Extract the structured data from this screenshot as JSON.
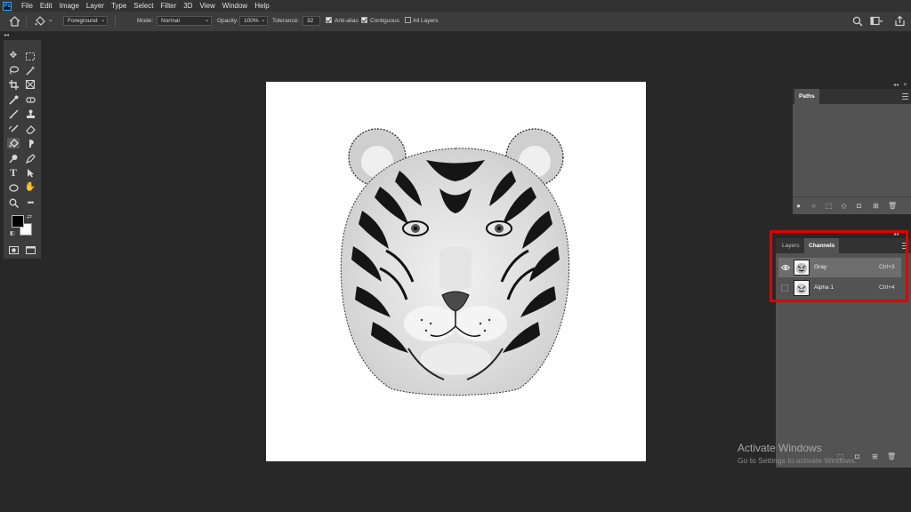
{
  "menubar": {
    "logo": "Ps",
    "items": [
      "File",
      "Edit",
      "Image",
      "Layer",
      "Type",
      "Select",
      "Filter",
      "3D",
      "View",
      "Window",
      "Help"
    ]
  },
  "options": {
    "fill_source": "Foreground",
    "mode_label": "Mode:",
    "mode_value": "Normal",
    "opacity_label": "Opacity:",
    "opacity_value": "100%",
    "tolerance_label": "Tolerance:",
    "tolerance_value": "32",
    "anti_alias": "Anti-alias",
    "contiguous": "Contiguous",
    "all_layers": "All Layers",
    "anti_alias_checked": true,
    "contiguous_checked": true,
    "all_layers_checked": false
  },
  "paths_panel": {
    "tab": "Paths"
  },
  "channels_panel": {
    "tabs": [
      "Layers",
      "Channels"
    ],
    "active_tab": "Channels",
    "rows": [
      {
        "name": "Gray",
        "shortcut": "Ctrl+3",
        "visible": true,
        "selected": true
      },
      {
        "name": "Alpha 1",
        "shortcut": "Ctrl+4",
        "visible": false,
        "selected": false
      }
    ]
  },
  "watermark": {
    "title": "Activate Windows",
    "subtitle": "Go to Settings to activate Windows."
  },
  "colors": {
    "highlight": "#e00000",
    "brand": "#31a8ff"
  },
  "icons": [
    "home-icon",
    "paint-bucket-icon",
    "search-icon",
    "workspace-icon",
    "share-icon",
    "move-tool-icon",
    "marquee-tool-icon",
    "lasso-tool-icon",
    "magic-wand-icon",
    "crop-tool-icon",
    "frame-tool-icon",
    "eyedropper-icon",
    "healing-brush-icon",
    "brush-tool-icon",
    "clone-stamp-icon",
    "history-brush-icon",
    "eraser-icon",
    "paint-bucket-tool-icon",
    "smudge-icon",
    "dodge-icon",
    "pen-tool-icon",
    "type-tool-icon",
    "path-selection-icon",
    "ellipse-tool-icon",
    "hand-tool-icon",
    "zoom-tool-icon",
    "more-tools-icon",
    "eye-icon",
    "trash-icon",
    "new-channel-icon",
    "mask-icon"
  ]
}
